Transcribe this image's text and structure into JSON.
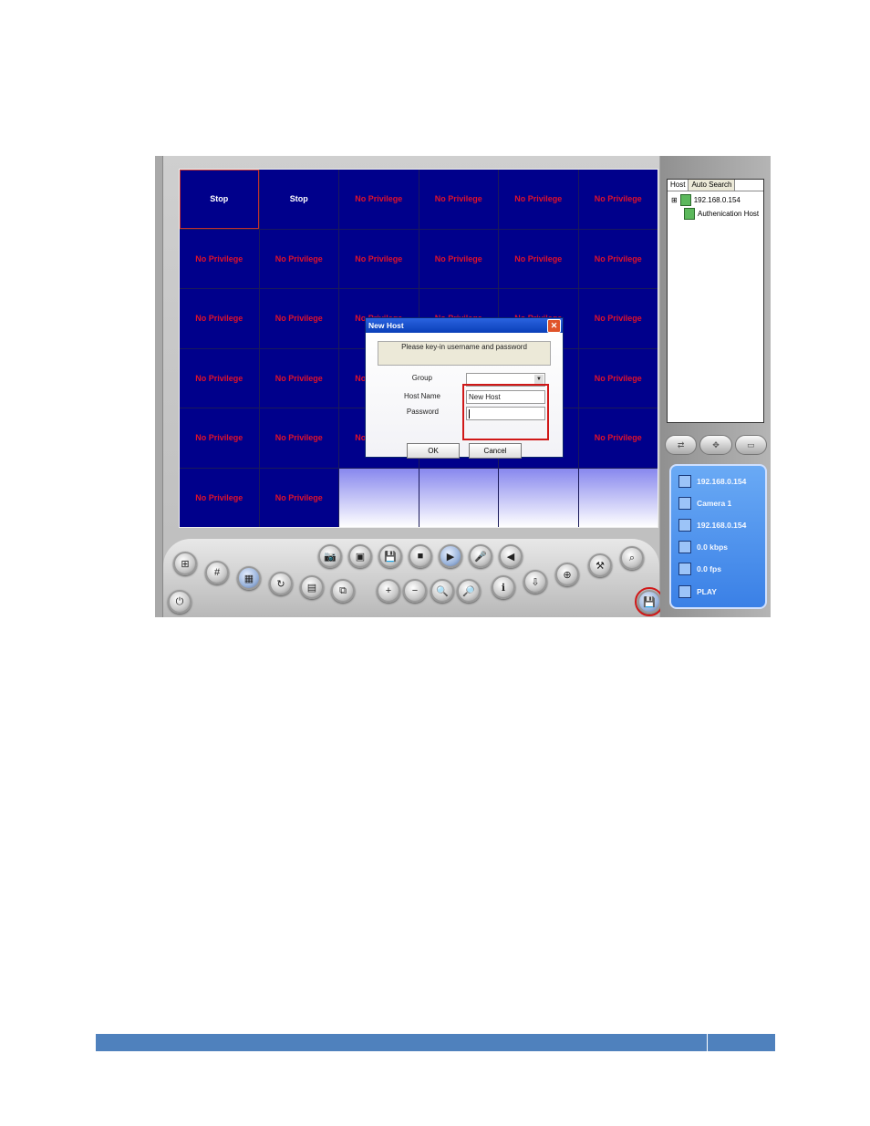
{
  "grid": {
    "cells": [
      "Stop",
      "Stop",
      "No Privilege",
      "No Privilege",
      "No Privilege",
      "No Privilege",
      "No Privilege",
      "No Privilege",
      "No Privilege",
      "No Privilege",
      "No Privilege",
      "No Privilege",
      "No Privilege",
      "No Privilege",
      "No Privilege",
      "No Privilege",
      "No Privilege",
      "No Privilege",
      "No Privilege",
      "No Privilege",
      "No Privilege",
      "No Privilege",
      "No Privilege",
      "No Privilege",
      "No Privilege",
      "No Privilege",
      "No Privilege",
      "No Privilege",
      "No Privilege",
      "No Privilege",
      "No Privilege",
      "No Privilege",
      "",
      "",
      "",
      ""
    ]
  },
  "dialog": {
    "title": "New Host",
    "close": "✕",
    "message": "Please key-in username and password",
    "group_label": "Group",
    "group_value": "",
    "hostname_label": "Host Name",
    "hostname_value": "New Host",
    "password_label": "Password",
    "password_value": "",
    "ok": "OK",
    "cancel": "Cancel"
  },
  "tree": {
    "tabs": [
      "Host",
      "Auto Search"
    ],
    "expand": "⊞",
    "host": "192.168.0.154",
    "child": "Authenication Host"
  },
  "info": {
    "rows": [
      "192.168.0.154",
      "Camera 1",
      "192.168.0.154",
      "0.0 kbps",
      "0.0 fps",
      "PLAY"
    ]
  },
  "colors": {
    "cell_bg": "#00008b",
    "no_privilege": "#e0102a",
    "highlight": "#d01818",
    "panel": "#3a80e6",
    "footer": "#4f81bd"
  }
}
